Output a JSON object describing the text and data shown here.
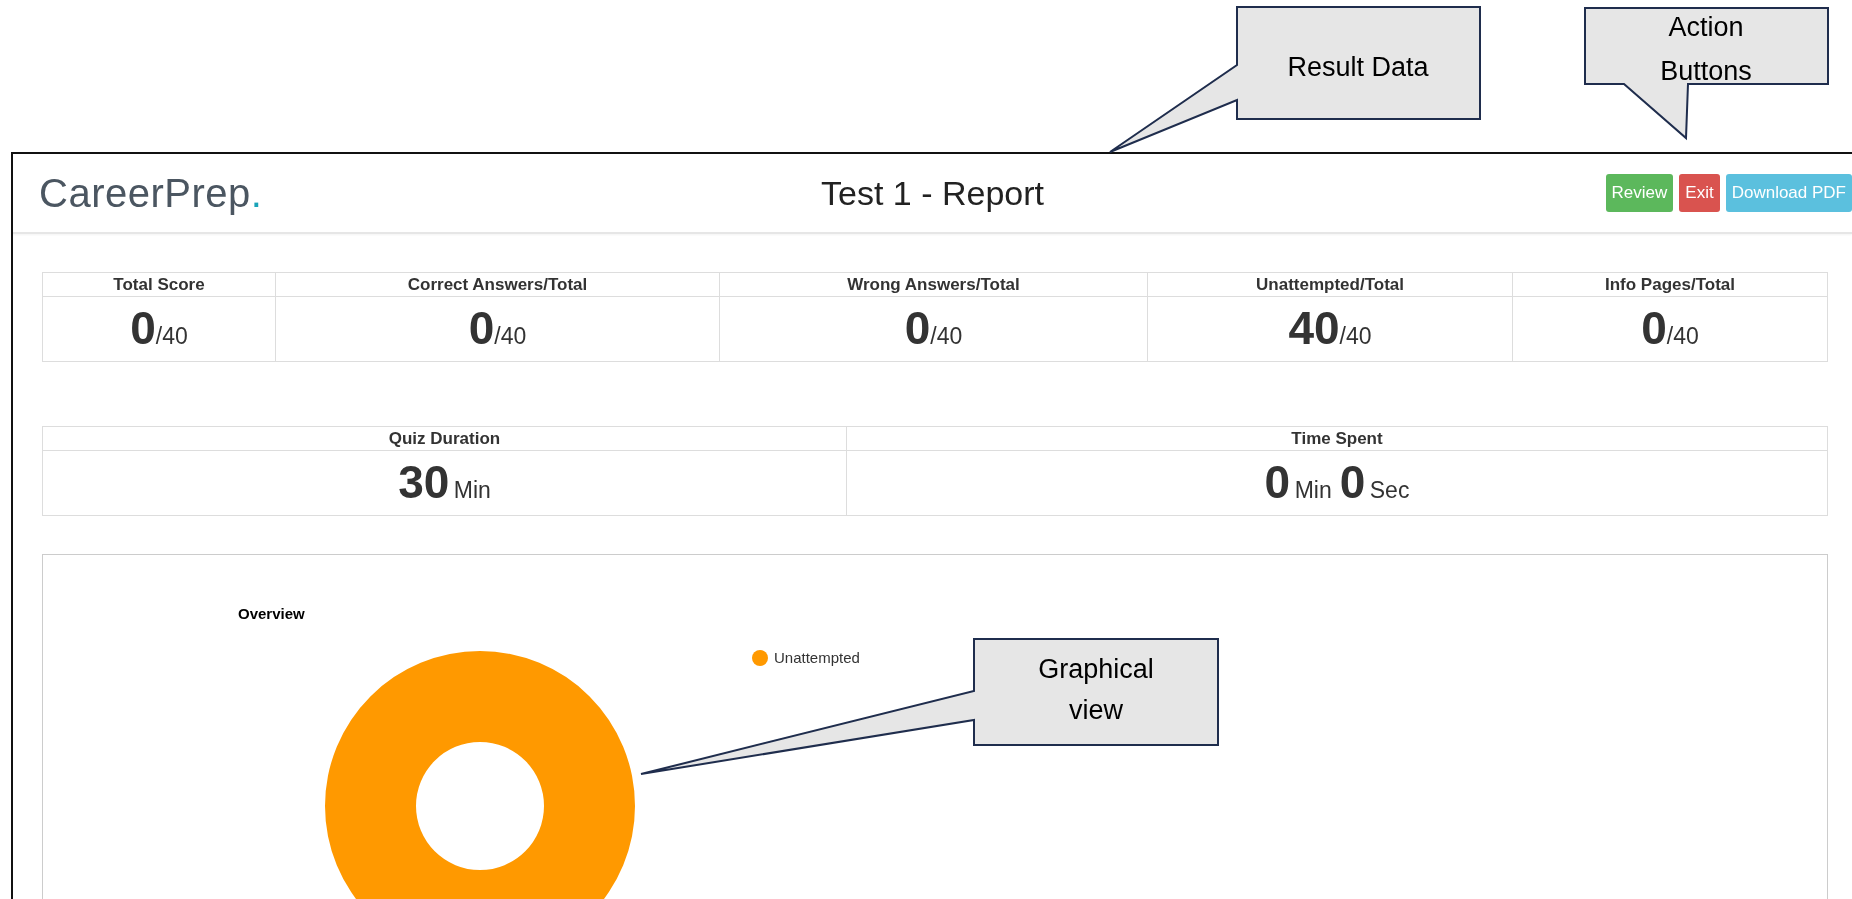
{
  "annotations": [
    {
      "lines": [
        "Result Data"
      ]
    },
    {
      "lines": [
        "Action",
        "Buttons"
      ]
    },
    {
      "lines": [
        "Graphical",
        "view"
      ]
    }
  ],
  "header": {
    "logo": "CareerPrep",
    "logo_mark": ".",
    "title": "Test 1 - Report",
    "buttons": [
      {
        "label": "Review",
        "kind": "success"
      },
      {
        "label": "Exit",
        "kind": "danger"
      },
      {
        "label": "Download PDF",
        "kind": "info"
      }
    ]
  },
  "scores": [
    {
      "label": "Total Score",
      "value": "0",
      "total": "/40"
    },
    {
      "label": "Correct Answers/Total",
      "value": "0",
      "total": "/40"
    },
    {
      "label": "Wrong Answers/Total",
      "value": "0",
      "total": "/40"
    },
    {
      "label": "Unattempted/Total",
      "value": "40",
      "total": "/40"
    },
    {
      "label": "Info Pages/Total",
      "value": "0",
      "total": "/40"
    }
  ],
  "durations": [
    {
      "label": "Quiz Duration",
      "parts": [
        {
          "value": "30",
          "unit": "Min"
        }
      ]
    },
    {
      "label": "Time Spent",
      "parts": [
        {
          "value": "0",
          "unit": "Min"
        },
        {
          "value": "0",
          "unit": "Sec"
        }
      ]
    }
  ],
  "overview": {
    "title": "Overview",
    "legend": [
      {
        "label": "Unattempted",
        "color": "#ff9900"
      }
    ]
  }
}
